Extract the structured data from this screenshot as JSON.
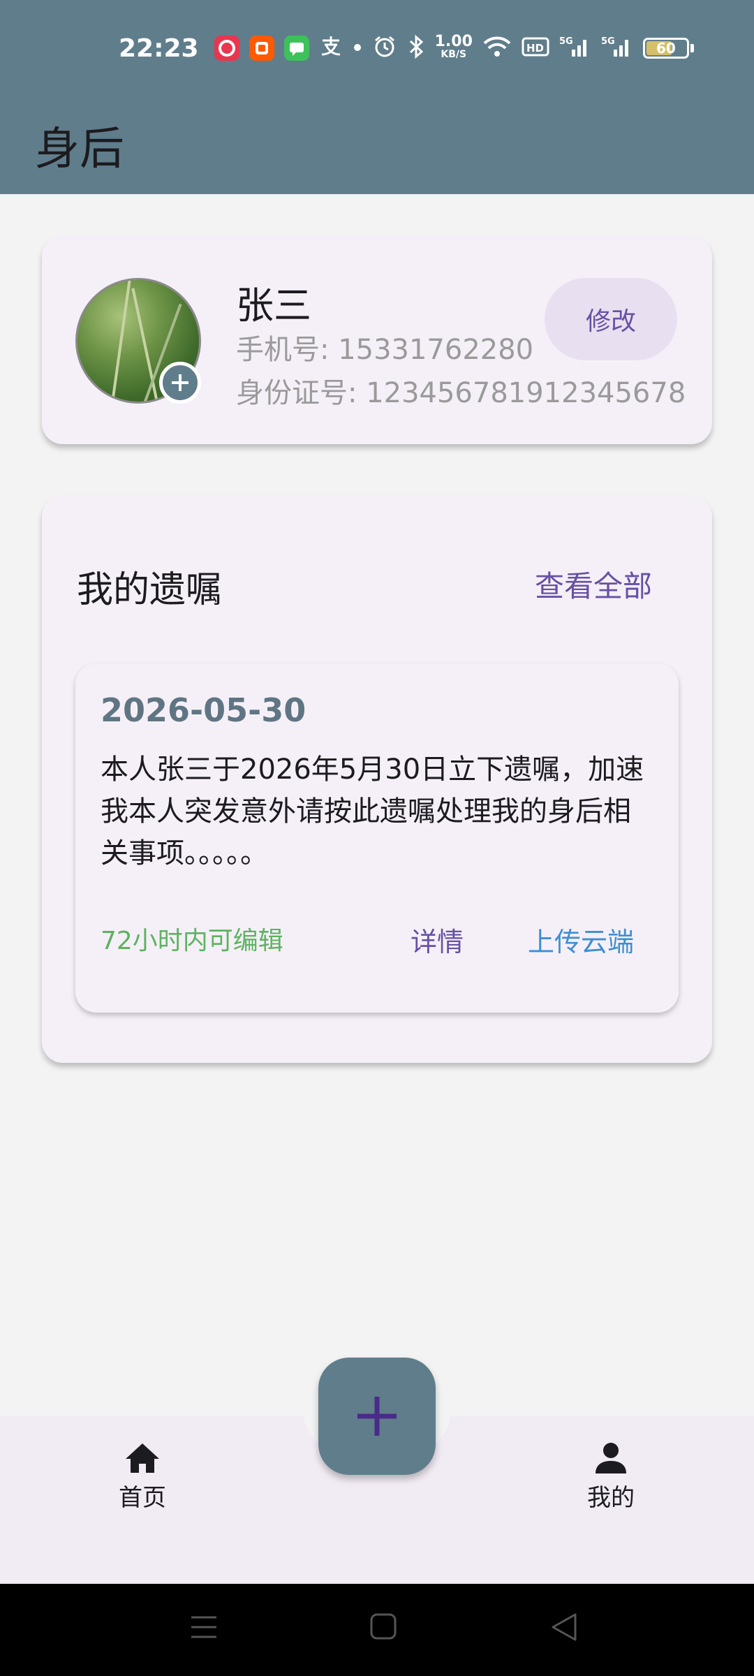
{
  "status_bar": {
    "time": "22:23",
    "net_speed_value": "1.00",
    "net_speed_unit": "KB/S",
    "battery": "60",
    "icons": [
      "taobao-618-icon",
      "taobao-icon",
      "messages-icon",
      "alipay-icon",
      "dot-icon",
      "alarm-icon",
      "bluetooth-icon",
      "wifi-icon",
      "hd-icon",
      "5g-signal-icon",
      "5g-signal-icon",
      "battery-icon"
    ]
  },
  "app_bar": {
    "title": "身后"
  },
  "profile": {
    "name": "张三",
    "phone": "手机号: 15331762280",
    "id_number": "身份证号: 123456781912345678",
    "edit_label": "修改",
    "avatar_add_icon": "plus-icon"
  },
  "wills": {
    "section_title": "我的遗嘱",
    "view_all_label": "查看全部",
    "items": [
      {
        "date": "2026-05-30",
        "content": "本人张三于2026年5月30日立下遗嘱，加速我本人突发意外请按此遗嘱处理我的身后相关事项。。。。。",
        "editable_note": "72小时内可编辑",
        "detail_label": "详情",
        "upload_label": "上传云端"
      }
    ]
  },
  "bottom_nav": {
    "home_label": "首页",
    "mine_label": "我的",
    "fab_icon": "plus-icon"
  },
  "colors": {
    "primary": "#607d8b",
    "accent": "#6750a4",
    "green": "#5db35f",
    "blue": "#3f8ed1"
  }
}
